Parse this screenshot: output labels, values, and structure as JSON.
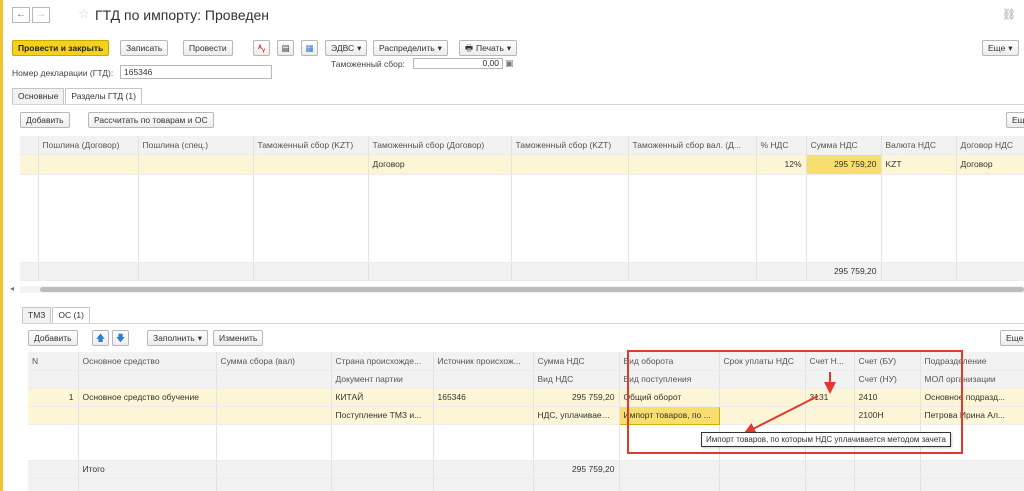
{
  "window": {
    "title": "ГТД по импорту: Проведен"
  },
  "toolbar": {
    "post_close": "Провести и закрыть",
    "save": "Записать",
    "post": "Провести",
    "edvs": "ЭДВС",
    "distribute": "Распределить",
    "print": "Печать",
    "more": "Еще"
  },
  "header_fields": {
    "declaration_label": "Номер декларации (ГТД):",
    "declaration_value": "165346",
    "customs_fee_label": "Таможенный сбор:",
    "customs_fee_value": "0,00"
  },
  "tabs": [
    "Основные",
    "Разделы ГТД (1)"
  ],
  "sections": {
    "add": "Добавить",
    "calc": "Рассчитать по товарам и ОС",
    "more": "Ещ",
    "columns": [
      "Пошлина (Договор)",
      "Пошлина (спец.)",
      "Таможенный сбор (KZT)",
      "Таможенный сбор (Договор)",
      "Таможенный сбор (KZT)",
      "Таможенный сбор вал. (Д...",
      "% НДС",
      "Сумма НДС",
      "Валюта НДС",
      "Договор НДС"
    ],
    "row": [
      "",
      "",
      "",
      "Договор",
      "",
      "",
      "12%",
      "295 759,20",
      "KZT",
      "Договор"
    ],
    "total": "295 759,20"
  },
  "subtabs": [
    "ТМЗ",
    "ОС (1)"
  ],
  "os": {
    "add": "Добавить",
    "fill": "Заполнить",
    "change": "Изменить",
    "more": "Еще",
    "head1": [
      "N",
      "Основное средство",
      "Сумма сбора (вал)",
      "Страна происхожде...",
      "Источник происхож...",
      "Сумма НДС",
      "Вид оборота",
      "Срок уплаты НДС",
      "Счет Н...",
      "Счет (БУ)",
      "Подразделение"
    ],
    "head2": [
      "",
      "",
      "",
      "Документ партии",
      "",
      "Вид НДС",
      "Вид поступления",
      "",
      "",
      "Счет (НУ)",
      "МОЛ организации"
    ],
    "row1": [
      "1",
      "Основное средство обучение",
      "",
      "КИТАЙ",
      "165346",
      "295 759,20",
      "Общий оборот",
      "",
      "3131",
      "2410",
      "Основное подразд..."
    ],
    "row2": [
      "",
      "",
      "",
      "Поступление ТМЗ и...",
      "",
      "НДС, уплачиваем...",
      "Импорт товаров, по ...",
      "",
      "",
      "2100Н",
      "Петрова Ирина Ал..."
    ],
    "total_label": "Итого",
    "total_value": "295 759,20"
  },
  "tooltip": "Импорт товаров, по которым НДС уплачивается методом зачета",
  "colors": {
    "accent": "#f5d11c",
    "annotation": "#e03a2f"
  }
}
